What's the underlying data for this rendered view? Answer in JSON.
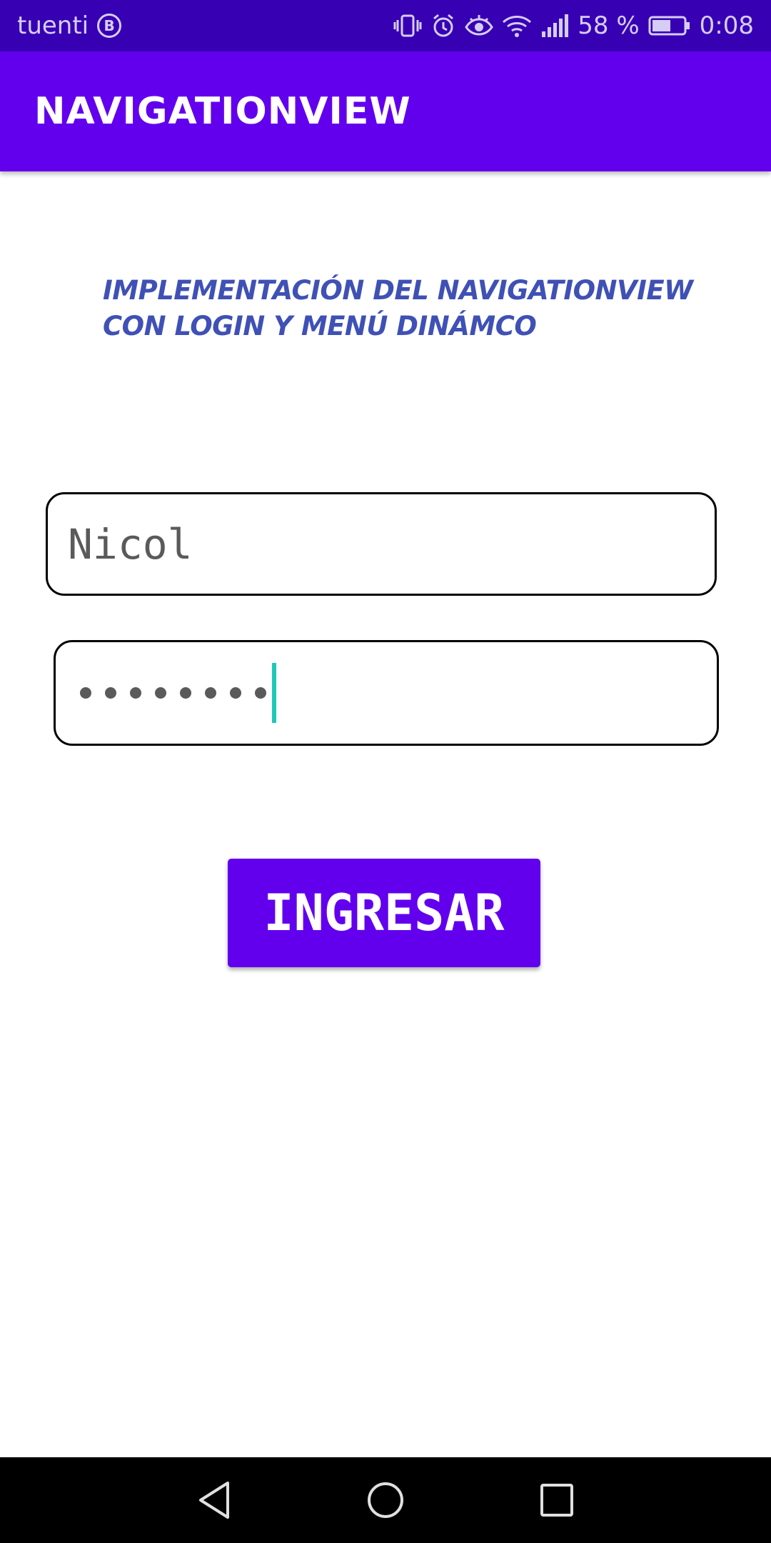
{
  "status_bar": {
    "carrier": "tuenti",
    "carrier_badge": "B",
    "battery_percent": "58 %",
    "time": "0:08",
    "icons": [
      "vibrate-icon",
      "alarm-icon",
      "eye-icon",
      "wifi-icon",
      "signal-icon",
      "battery-icon"
    ]
  },
  "app_bar": {
    "title": "NAVIGATIONVIEW"
  },
  "main": {
    "heading": "IMPLEMENTACIÓN DEL NAVIGATIONVIEW CON LOGIN Y MENÚ DINÁMCO",
    "username": {
      "value": "Nicol"
    },
    "password": {
      "masked_length": 8
    },
    "login_button": "INGRESAR"
  },
  "nav_bar": {
    "icons": [
      "back-icon",
      "home-icon",
      "recents-icon"
    ]
  },
  "colors": {
    "status_bar": "#3700b3",
    "primary": "#6200ee",
    "heading": "#3f51b5",
    "cursor": "#1fc7b6"
  }
}
